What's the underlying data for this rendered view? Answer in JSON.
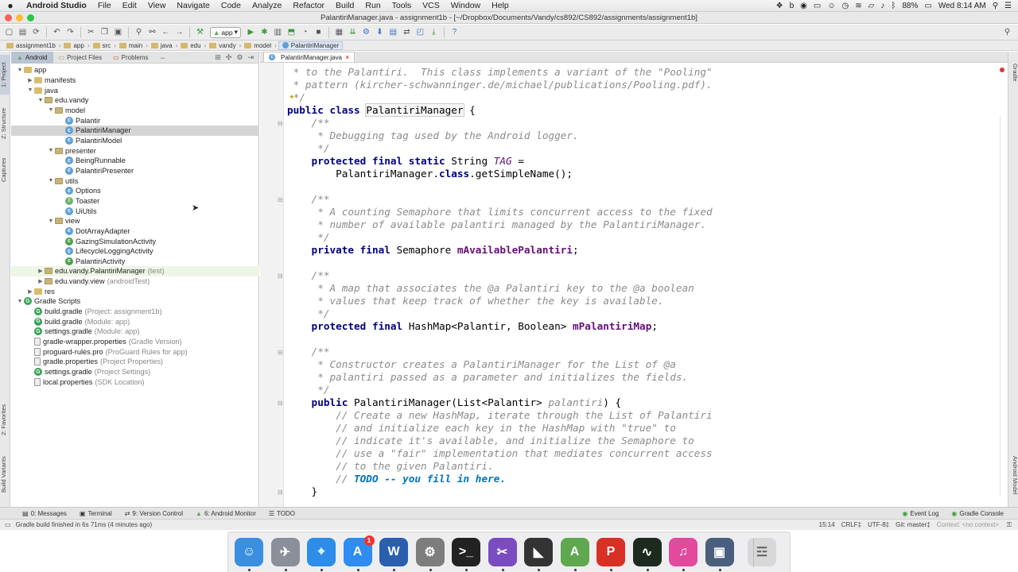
{
  "menubar": {
    "app_name": "Android Studio",
    "items": [
      "File",
      "Edit",
      "View",
      "Navigate",
      "Code",
      "Analyze",
      "Refactor",
      "Build",
      "Run",
      "Tools",
      "VCS",
      "Window",
      "Help"
    ],
    "battery": "88%",
    "clock": "Wed 8:14 AM"
  },
  "window": {
    "title": "PalantiriManager.java - assignment1b - [~/Dropbox/Documents/Vandy/cs892/CS892/assignments/assignment1b]"
  },
  "toolbar": {
    "run_config": "app"
  },
  "breadcrumbs": [
    "assignment1b",
    "app",
    "src",
    "main",
    "java",
    "edu",
    "vandy",
    "model",
    "PalantiriManager"
  ],
  "project_panel": {
    "tabs": [
      "Android",
      "Project Files",
      "Problems"
    ],
    "tree": [
      {
        "label": "app",
        "icon": "folder",
        "depth": 0,
        "open": true
      },
      {
        "label": "manifests",
        "icon": "folder",
        "depth": 1,
        "open": false
      },
      {
        "label": "java",
        "icon": "folder",
        "depth": 1,
        "open": true
      },
      {
        "label": "edu.vandy",
        "icon": "package",
        "depth": 2,
        "open": true
      },
      {
        "label": "model",
        "icon": "package",
        "depth": 3,
        "open": true
      },
      {
        "label": "Palantir",
        "icon": "class",
        "depth": 4
      },
      {
        "label": "PalantiriManager",
        "icon": "class",
        "depth": 4,
        "selected": true
      },
      {
        "label": "PalantiriModel",
        "icon": "class",
        "depth": 4
      },
      {
        "label": "presenter",
        "icon": "package",
        "depth": 3,
        "open": true
      },
      {
        "label": "BeingRunnable",
        "icon": "class",
        "depth": 4
      },
      {
        "label": "PalantiriPresenter",
        "icon": "class",
        "depth": 4
      },
      {
        "label": "utils",
        "icon": "package",
        "depth": 3,
        "open": true
      },
      {
        "label": "Options",
        "icon": "class",
        "depth": 4
      },
      {
        "label": "Toaster",
        "icon": "interface",
        "depth": 4
      },
      {
        "label": "UiUtils",
        "icon": "class",
        "depth": 4
      },
      {
        "label": "view",
        "icon": "package",
        "depth": 3,
        "open": true
      },
      {
        "label": "DotArrayAdapter",
        "icon": "class",
        "depth": 4
      },
      {
        "label": "GazingSimulationActivity",
        "icon": "activity",
        "depth": 4
      },
      {
        "label": "LifecycleLoggingActivity",
        "icon": "class",
        "depth": 4
      },
      {
        "label": "PalantiriActivity",
        "icon": "activity",
        "depth": 4
      },
      {
        "label": "edu.vandy.PalantiriManager",
        "suffix": "(test)",
        "icon": "package",
        "depth": 2,
        "open": false,
        "test": true
      },
      {
        "label": "edu.vandy.view",
        "suffix": "(androidTest)",
        "icon": "package",
        "depth": 2,
        "open": false
      },
      {
        "label": "res",
        "icon": "folder",
        "depth": 1,
        "open": false
      },
      {
        "label": "Gradle Scripts",
        "icon": "gradle",
        "depth": 0,
        "open": true
      },
      {
        "label": "build.gradle",
        "suffix": "(Project: assignment1b)",
        "icon": "gradle",
        "depth": 1
      },
      {
        "label": "build.gradle",
        "suffix": "(Module: app)",
        "icon": "gradle",
        "depth": 1
      },
      {
        "label": "settings.gradle",
        "suffix": "(Module: app)",
        "icon": "gradle",
        "depth": 1
      },
      {
        "label": "gradle-wrapper.properties",
        "suffix": "(Gradle Version)",
        "icon": "file",
        "depth": 1
      },
      {
        "label": "proguard-rules.pro",
        "suffix": "(ProGuard Rules for app)",
        "icon": "file",
        "depth": 1
      },
      {
        "label": "gradle.properties",
        "suffix": "(Project Properties)",
        "icon": "file",
        "depth": 1
      },
      {
        "label": "settings.gradle",
        "suffix": "(Project Settings)",
        "icon": "gradle",
        "depth": 1
      },
      {
        "label": "local.properties",
        "suffix": "(SDK Location)",
        "icon": "file",
        "depth": 1
      }
    ]
  },
  "editor": {
    "tab_label": "PalantiriManager.java",
    "lines": [
      [
        {
          "t": " * to the Palantiri.  This class implements a variant of the \"Pooling\"",
          "c": "cm"
        }
      ],
      [
        {
          "t": " * pattern (kircher-schwanninger.de/michael/publications/Pooling.pdf).",
          "c": "cm"
        }
      ],
      [
        {
          "t": " */",
          "c": "cm"
        }
      ],
      [
        {
          "t": "public class ",
          "c": "kw"
        },
        {
          "t": "PalantiriManager",
          "c": "hl"
        },
        {
          "t": " {",
          "c": ""
        }
      ],
      [
        {
          "t": "    /**",
          "c": "cm"
        }
      ],
      [
        {
          "t": "     * Debugging tag used by the Android logger.",
          "c": "cm"
        }
      ],
      [
        {
          "t": "     */",
          "c": "cm"
        }
      ],
      [
        {
          "t": "    protected final static ",
          "c": "kw"
        },
        {
          "t": "String ",
          "c": ""
        },
        {
          "t": "TAG",
          "c": "st"
        },
        {
          "t": " =",
          "c": ""
        }
      ],
      [
        {
          "t": "        PalantiriManager.",
          "c": ""
        },
        {
          "t": "class",
          "c": "kw"
        },
        {
          "t": ".getSimpleName();",
          "c": ""
        }
      ],
      [
        {
          "t": "",
          "c": ""
        }
      ],
      [
        {
          "t": "    /**",
          "c": "cm"
        }
      ],
      [
        {
          "t": "     * A counting Semaphore that limits concurrent access to the fixed",
          "c": "cm"
        }
      ],
      [
        {
          "t": "     * number of available palantiri managed by the PalantiriManager.",
          "c": "cm"
        }
      ],
      [
        {
          "t": "     */",
          "c": "cm"
        }
      ],
      [
        {
          "t": "    private final ",
          "c": "kw"
        },
        {
          "t": "Semaphore ",
          "c": ""
        },
        {
          "t": "mAvailablePalantiri",
          "c": "fld"
        },
        {
          "t": ";",
          "c": ""
        }
      ],
      [
        {
          "t": "",
          "c": ""
        }
      ],
      [
        {
          "t": "    /**",
          "c": "cm"
        }
      ],
      [
        {
          "t": "     * A map that associates the @a Palantiri key to the @a boolean",
          "c": "cm"
        }
      ],
      [
        {
          "t": "     * values that keep track of whether the key is available.",
          "c": "cm"
        }
      ],
      [
        {
          "t": "     */",
          "c": "cm"
        }
      ],
      [
        {
          "t": "    protected final ",
          "c": "kw"
        },
        {
          "t": "HashMap<Palantir, Boolean> ",
          "c": ""
        },
        {
          "t": "mPalantiriMap",
          "c": "fld"
        },
        {
          "t": ";",
          "c": ""
        }
      ],
      [
        {
          "t": "",
          "c": ""
        }
      ],
      [
        {
          "t": "    /**",
          "c": "cm"
        }
      ],
      [
        {
          "t": "     * Constructor creates a PalantiriManager for the List of @a",
          "c": "cm"
        }
      ],
      [
        {
          "t": "     * palantiri passed as a parameter and initializes the fields.",
          "c": "cm"
        }
      ],
      [
        {
          "t": "     */",
          "c": "cm"
        }
      ],
      [
        {
          "t": "    public ",
          "c": "kw"
        },
        {
          "t": "PalantiriManager(List<Palantir> ",
          "c": ""
        },
        {
          "t": "palantiri",
          "c": "cm"
        },
        {
          "t": ") {",
          "c": ""
        }
      ],
      [
        {
          "t": "        // Create a new HashMap, iterate through the List of Palantiri",
          "c": "cm"
        }
      ],
      [
        {
          "t": "        // and initialize each key in the HashMap with \"true\" to",
          "c": "cm"
        }
      ],
      [
        {
          "t": "        // indicate it's available, and initialize the Semaphore to",
          "c": "cm"
        }
      ],
      [
        {
          "t": "        // use a \"fair\" implementation that mediates concurrent access",
          "c": "cm"
        }
      ],
      [
        {
          "t": "        // to the given Palantiri.",
          "c": "cm"
        }
      ],
      [
        {
          "t": "        // ",
          "c": "cm"
        },
        {
          "t": "TODO -- you fill in here.",
          "c": "todo"
        }
      ],
      [
        {
          "t": "    }",
          "c": ""
        }
      ]
    ]
  },
  "left_strip": {
    "project": "1: Project",
    "structure": "Z: Structure",
    "captures": "Captures",
    "favorites": "2: Favorites",
    "build_variants": "Build Variants"
  },
  "right_strip": {
    "gradle": "Gradle",
    "android_model": "Android Model"
  },
  "bottom_tools": {
    "messages": "0: Messages",
    "terminal": "Terminal",
    "version_control": "9: Version Control",
    "android_monitor": "6: Android Monitor",
    "todo": "TODO",
    "event_log": "Event Log",
    "gradle_console": "Gradle Console"
  },
  "status": {
    "message": "Gradle build finished in 6s 71ms (4 minutes ago)",
    "position": "15:14",
    "line_sep": "CRLF‡",
    "encoding": "UTF-8‡",
    "git": "Git: master‡",
    "context": "Context: <no context>"
  },
  "dock": [
    {
      "name": "finder",
      "color": "#3a8fe0",
      "glyph": "☺"
    },
    {
      "name": "launchpad",
      "color": "#8a8f99",
      "glyph": "✈"
    },
    {
      "name": "safari",
      "color": "#2d8de8",
      "glyph": "⌖"
    },
    {
      "name": "app-store",
      "color": "#2f8cf0",
      "glyph": "A",
      "badge": "1"
    },
    {
      "name": "word",
      "color": "#2a5fae",
      "glyph": "W"
    },
    {
      "name": "system-preferences",
      "color": "#7d7d7d",
      "glyph": "⚙"
    },
    {
      "name": "terminal",
      "color": "#222222",
      "glyph": ">_"
    },
    {
      "name": "intellij",
      "color": "#7b4bc2",
      "glyph": "✂"
    },
    {
      "name": "sublime",
      "color": "#333333",
      "glyph": "◣"
    },
    {
      "name": "android-studio",
      "color": "#5fa84f",
      "glyph": "A"
    },
    {
      "name": "wps",
      "color": "#d93025",
      "glyph": "P"
    },
    {
      "name": "activity-monitor",
      "color": "#1f2a1f",
      "glyph": "∿"
    },
    {
      "name": "itunes",
      "color": "#e24a9e",
      "glyph": "♫"
    },
    {
      "name": "screen-recorder",
      "color": "#4a5f7e",
      "glyph": "▣"
    },
    {
      "name": "trash",
      "color": "#d8d8d8",
      "glyph": "☲"
    }
  ]
}
